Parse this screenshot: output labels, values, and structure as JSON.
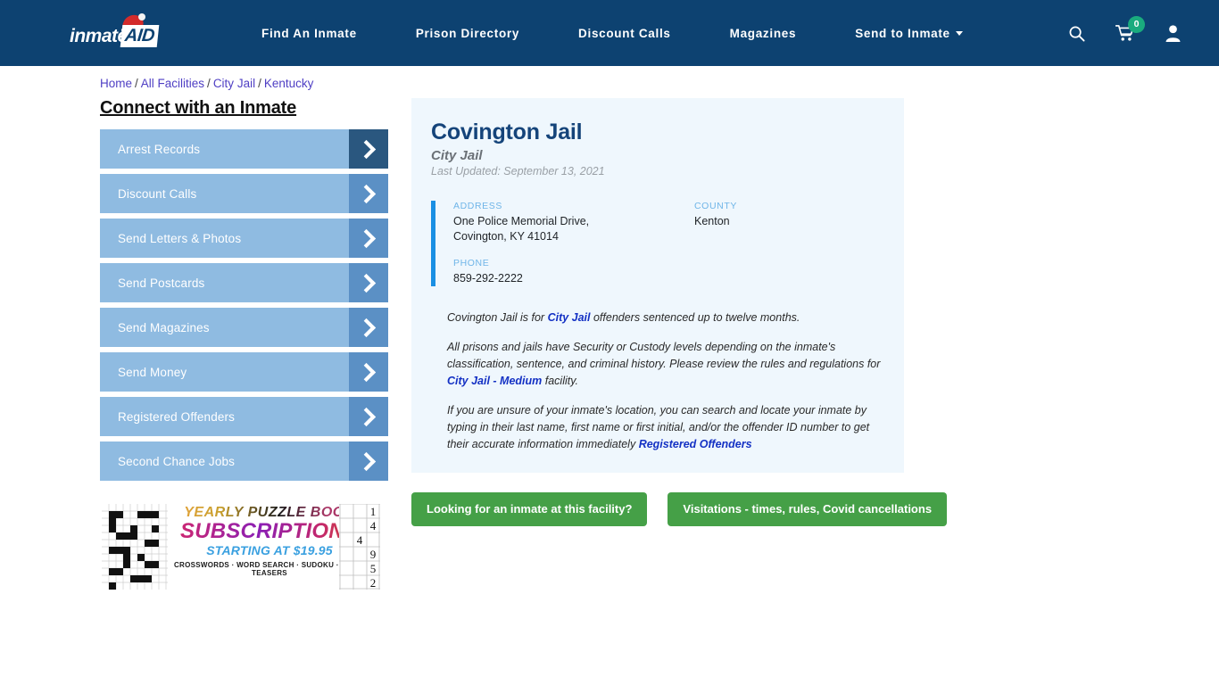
{
  "header": {
    "brand": {
      "part1": "inmate",
      "part2": "AID",
      "hat_icon": "santa-hat-icon"
    },
    "nav_items": [
      {
        "label": "Find An Inmate",
        "has_caret": false
      },
      {
        "label": "Prison Directory",
        "has_caret": false
      },
      {
        "label": "Discount Calls",
        "has_caret": false
      },
      {
        "label": "Magazines",
        "has_caret": false
      },
      {
        "label": "Send to Inmate",
        "has_caret": true
      }
    ],
    "icons": {
      "search": "search-icon",
      "cart": "shopping-cart-icon",
      "account": "user-account-icon"
    },
    "cart_count": "0",
    "bg_color": "#0d4271",
    "badge_color": "#1aab7e"
  },
  "breadcrumb": {
    "items": [
      "Home",
      "All Facilities",
      "City Jail",
      "Kentucky"
    ],
    "separator": "/"
  },
  "sidebar": {
    "title": "Connect with an Inmate",
    "items": [
      {
        "label": "Arrest Records",
        "active": true
      },
      {
        "label": "Discount Calls",
        "active": false
      },
      {
        "label": "Send Letters & Photos",
        "active": false
      },
      {
        "label": "Send Postcards",
        "active": false
      },
      {
        "label": "Send Magazines",
        "active": false
      },
      {
        "label": "Send Money",
        "active": false
      },
      {
        "label": "Registered Offenders",
        "active": false
      },
      {
        "label": "Second Chance Jobs",
        "active": false
      }
    ],
    "button_color": "#8fbbe1",
    "arrow_color": "#5b90c5",
    "arrow_active_color": "#2a577f"
  },
  "ad": {
    "line1": "YEARLY PUZZLE BOOK",
    "line2": "SUBSCRIPTIONS",
    "line3": "STARTING AT $19.95",
    "line4": "CROSSWORDS · WORD SEARCH · SUDOKU · BRAIN TEASERS",
    "sudoku_digits": [
      "1",
      "4",
      "4",
      "9",
      "5",
      "2"
    ]
  },
  "facility": {
    "name": "Covington Jail",
    "type": "City Jail",
    "last_updated": "Last Updated: September 13, 2021",
    "address_label": "ADDRESS",
    "address_value": "One Police Memorial Drive, Covington, KY 41014",
    "phone_label": "PHONE",
    "phone_value": "859-292-2222",
    "county_label": "COUNTY",
    "county_value": "Kenton",
    "accent_color": "#1a8fe3",
    "card_bg": "#eff7fd",
    "paragraph1": {
      "before": "Covington Jail is for ",
      "link": "City Jail",
      "after": " offenders sentenced up to twelve months."
    },
    "paragraph2": {
      "before": "All prisons and jails have Security or Custody levels depending on the inmate's classification, sentence, and criminal history. Please review the rules and regulations for ",
      "link": "City Jail - Medium",
      "after": " facility."
    },
    "paragraph3": {
      "before": "If you are unsure of your inmate's location, you can search and locate your inmate by typing in their last name, first name or first initial, and/or the offender ID number to get their accurate information immediately ",
      "link": "Registered Offenders",
      "after": ""
    },
    "cta": [
      {
        "label": "Looking for an inmate at this facility?"
      },
      {
        "label": "Visitations - times, rules, Covid cancellations"
      }
    ],
    "cta_color": "#45a047"
  }
}
